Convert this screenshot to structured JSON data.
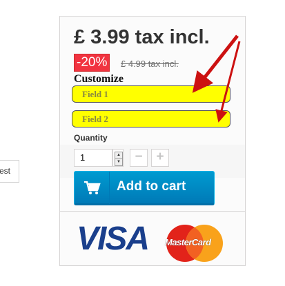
{
  "side_button": {
    "label": "est"
  },
  "product": {
    "price": "£ 3.99 tax incl.",
    "discount": "-20%",
    "old_price": "£ 4.99 tax incl."
  },
  "customize": {
    "heading": "Customize",
    "fields": [
      {
        "label": "Field 1"
      },
      {
        "label": "Field 2"
      }
    ]
  },
  "quantity": {
    "label": "Quantity",
    "value": "1",
    "minus": "−",
    "plus": "+"
  },
  "cart": {
    "add_label": "Add to cart",
    "icon": "cart-icon"
  },
  "payment": {
    "visa": "VISA",
    "mastercard": "MasterCard"
  },
  "colors": {
    "accent": "#0088c7",
    "discount": "#f13340",
    "field_highlight": "#ffff00",
    "arrow": "#cc1111"
  }
}
